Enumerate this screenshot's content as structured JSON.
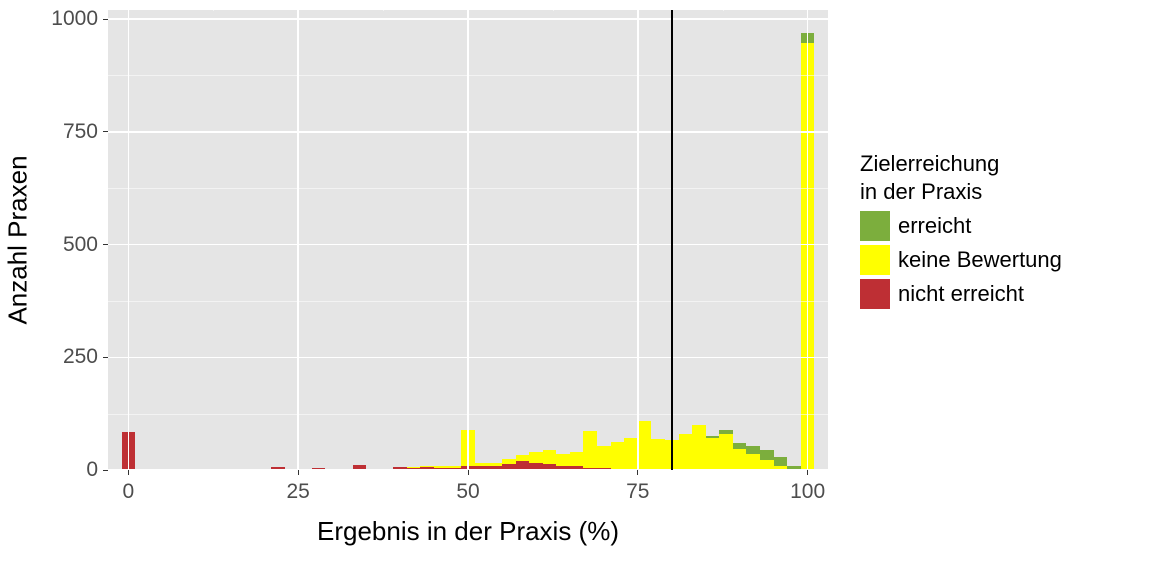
{
  "chart_data": {
    "type": "bar",
    "stacked": true,
    "title": "",
    "xlabel": "Ergebnis in der Praxis (%)",
    "ylabel": "Anzahl Praxen",
    "xlim": [
      -3,
      103
    ],
    "ylim": [
      0,
      1020
    ],
    "x_breaks": [
      0,
      25,
      50,
      75,
      100
    ],
    "y_breaks": [
      0,
      250,
      500,
      750,
      1000
    ],
    "legend_title": "Zielerreichung\nin der Praxis",
    "vline_x": 80,
    "colors": {
      "erreicht": "#7CAE3D",
      "keine Bewertung": "#FFFF00",
      "nicht erreicht": "#BE2F34"
    },
    "series_order": [
      "nicht erreicht",
      "keine Bewertung",
      "erreicht"
    ],
    "legend_order": [
      "erreicht",
      "keine Bewertung",
      "nicht erreicht"
    ],
    "bin_width": 2,
    "bars": [
      {
        "x": 0,
        "nicht erreicht": 85,
        "keine Bewertung": 0,
        "erreicht": 0
      },
      {
        "x": 22,
        "nicht erreicht": 6,
        "keine Bewertung": 0,
        "erreicht": 0
      },
      {
        "x": 26,
        "nicht erreicht": 3,
        "keine Bewertung": 0,
        "erreicht": 0
      },
      {
        "x": 28,
        "nicht erreicht": 4,
        "keine Bewertung": 0,
        "erreicht": 0
      },
      {
        "x": 34,
        "nicht erreicht": 12,
        "keine Bewertung": 0,
        "erreicht": 0
      },
      {
        "x": 38,
        "nicht erreicht": 2,
        "keine Bewertung": 0,
        "erreicht": 0
      },
      {
        "x": 40,
        "nicht erreicht": 6,
        "keine Bewertung": 0,
        "erreicht": 0
      },
      {
        "x": 42,
        "nicht erreicht": 4,
        "keine Bewertung": 2,
        "erreicht": 0
      },
      {
        "x": 44,
        "nicht erreicht": 6,
        "keine Bewertung": 2,
        "erreicht": 0
      },
      {
        "x": 46,
        "nicht erreicht": 5,
        "keine Bewertung": 4,
        "erreicht": 0
      },
      {
        "x": 48,
        "nicht erreicht": 5,
        "keine Bewertung": 4,
        "erreicht": 0
      },
      {
        "x": 50,
        "nicht erreicht": 8,
        "keine Bewertung": 80,
        "erreicht": 0
      },
      {
        "x": 52,
        "nicht erreicht": 8,
        "keine Bewertung": 8,
        "erreicht": 0
      },
      {
        "x": 54,
        "nicht erreicht": 10,
        "keine Bewertung": 6,
        "erreicht": 0
      },
      {
        "x": 56,
        "nicht erreicht": 14,
        "keine Bewertung": 10,
        "erreicht": 0
      },
      {
        "x": 58,
        "nicht erreicht": 20,
        "keine Bewertung": 14,
        "erreicht": 0
      },
      {
        "x": 60,
        "nicht erreicht": 16,
        "keine Bewertung": 24,
        "erreicht": 0
      },
      {
        "x": 62,
        "nicht erreicht": 14,
        "keine Bewertung": 30,
        "erreicht": 0
      },
      {
        "x": 64,
        "nicht erreicht": 10,
        "keine Bewertung": 26,
        "erreicht": 0
      },
      {
        "x": 66,
        "nicht erreicht": 8,
        "keine Bewertung": 32,
        "erreicht": 0
      },
      {
        "x": 68,
        "nicht erreicht": 4,
        "keine Bewertung": 82,
        "erreicht": 0
      },
      {
        "x": 70,
        "nicht erreicht": 4,
        "keine Bewertung": 50,
        "erreicht": 0
      },
      {
        "x": 72,
        "nicht erreicht": 0,
        "keine Bewertung": 62,
        "erreicht": 0
      },
      {
        "x": 74,
        "nicht erreicht": 0,
        "keine Bewertung": 70,
        "erreicht": 0
      },
      {
        "x": 76,
        "nicht erreicht": 0,
        "keine Bewertung": 108,
        "erreicht": 0
      },
      {
        "x": 78,
        "nicht erreicht": 0,
        "keine Bewertung": 68,
        "erreicht": 0
      },
      {
        "x": 80,
        "nicht erreicht": 0,
        "keine Bewertung": 66,
        "erreicht": 0
      },
      {
        "x": 82,
        "nicht erreicht": 0,
        "keine Bewertung": 80,
        "erreicht": 0
      },
      {
        "x": 84,
        "nicht erreicht": 0,
        "keine Bewertung": 100,
        "erreicht": 0
      },
      {
        "x": 86,
        "nicht erreicht": 0,
        "keine Bewertung": 72,
        "erreicht": 4
      },
      {
        "x": 88,
        "nicht erreicht": 0,
        "keine Bewertung": 80,
        "erreicht": 8
      },
      {
        "x": 90,
        "nicht erreicht": 0,
        "keine Bewertung": 46,
        "erreicht": 14
      },
      {
        "x": 92,
        "nicht erreicht": 0,
        "keine Bewertung": 36,
        "erreicht": 18
      },
      {
        "x": 94,
        "nicht erreicht": 0,
        "keine Bewertung": 22,
        "erreicht": 22
      },
      {
        "x": 96,
        "nicht erreicht": 0,
        "keine Bewertung": 10,
        "erreicht": 18
      },
      {
        "x": 98,
        "nicht erreicht": 0,
        "keine Bewertung": 0,
        "erreicht": 10
      },
      {
        "x": 100,
        "nicht erreicht": 0,
        "keine Bewertung": 946,
        "erreicht": 22
      }
    ]
  }
}
